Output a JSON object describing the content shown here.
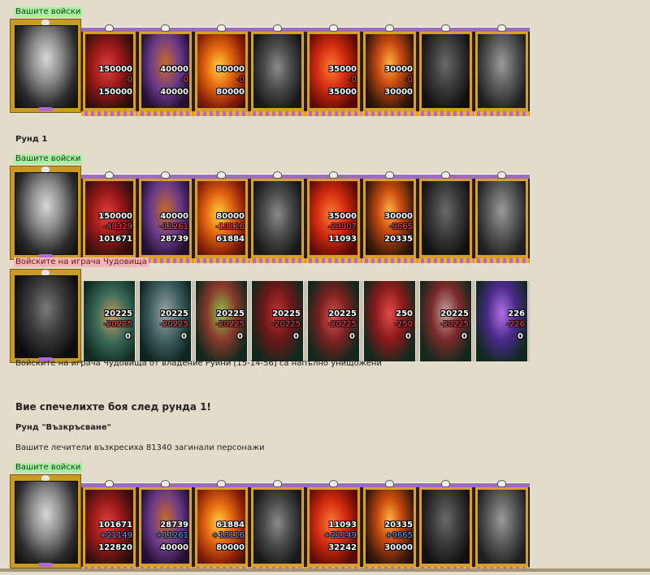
{
  "colors": {
    "background": "#e4dccb",
    "own_label_bg": "#a6f0a0",
    "enemy_label_bg": "#f7b4b4",
    "loss": "#ff4a4a",
    "gain": "#5ea0ff"
  },
  "armies": {
    "initial": {
      "label": "Вашите войски",
      "units": [
        {
          "top": "150000",
          "mid": "-0",
          "bot": "150000"
        },
        {
          "top": "40000",
          "mid": "-0",
          "bot": "40000"
        },
        {
          "top": "80000",
          "mid": "-0",
          "bot": "80000"
        },
        {
          "top": "",
          "mid": "",
          "bot": ""
        },
        {
          "top": "35000",
          "mid": "-0",
          "bot": "35000"
        },
        {
          "top": "30000",
          "mid": "-0",
          "bot": "30000"
        },
        {
          "top": "",
          "mid": "",
          "bot": ""
        },
        {
          "top": "",
          "mid": "",
          "bot": ""
        }
      ]
    },
    "round1_own": {
      "label": "Вашите войски",
      "units": [
        {
          "top": "150000",
          "mid": "-48329",
          "bot": "101671"
        },
        {
          "top": "40000",
          "mid": "-11261",
          "bot": "28739"
        },
        {
          "top": "80000",
          "mid": "-18116",
          "bot": "61884"
        },
        {
          "top": "",
          "mid": "",
          "bot": ""
        },
        {
          "top": "35000",
          "mid": "-23907",
          "bot": "11093"
        },
        {
          "top": "30000",
          "mid": "-9665",
          "bot": "20335"
        },
        {
          "top": "",
          "mid": "",
          "bot": ""
        },
        {
          "top": "",
          "mid": "",
          "bot": ""
        }
      ]
    },
    "round1_enemy": {
      "label": "Войските на играча Чудовища",
      "units": [
        {
          "top": "20225",
          "mid": "-20225",
          "bot": "0"
        },
        {
          "top": "20225",
          "mid": "-20225",
          "bot": "0"
        },
        {
          "top": "20225",
          "mid": "-20225",
          "bot": "0"
        },
        {
          "top": "20225",
          "mid": "-20225",
          "bot": "0"
        },
        {
          "top": "20225",
          "mid": "-20225",
          "bot": "0"
        },
        {
          "top": "250",
          "mid": "-250",
          "bot": "0"
        },
        {
          "top": "20225",
          "mid": "-20225",
          "bot": "0"
        },
        {
          "top": "226",
          "mid": "-226",
          "bot": "0"
        }
      ]
    },
    "resurrect": {
      "label": "Вашите войски",
      "units": [
        {
          "top": "101671",
          "mid": "+21149",
          "bot": "122820"
        },
        {
          "top": "28739",
          "mid": "+11261",
          "bot": "40000"
        },
        {
          "top": "61884",
          "mid": "+18116",
          "bot": "80000"
        },
        {
          "top": "",
          "mid": "",
          "bot": ""
        },
        {
          "top": "11093",
          "mid": "+21149",
          "bot": "32242"
        },
        {
          "top": "20335",
          "mid": "+9665",
          "bot": "30000"
        },
        {
          "top": "",
          "mid": "",
          "bot": ""
        },
        {
          "top": "",
          "mid": "",
          "bot": ""
        }
      ]
    }
  },
  "texts": {
    "round_title": "Рунд 1",
    "destroyed": "Войските на играча Чудовища от владение Руини [15-14-56] са напълно унищожени",
    "victory": "Вие спечелихте боя след рунда 1!",
    "resurrect_title": "Рунд \"Възкръсване\"",
    "resurrect_text": "Вашите лечители възкресиха 81340 загинали персонажи"
  }
}
